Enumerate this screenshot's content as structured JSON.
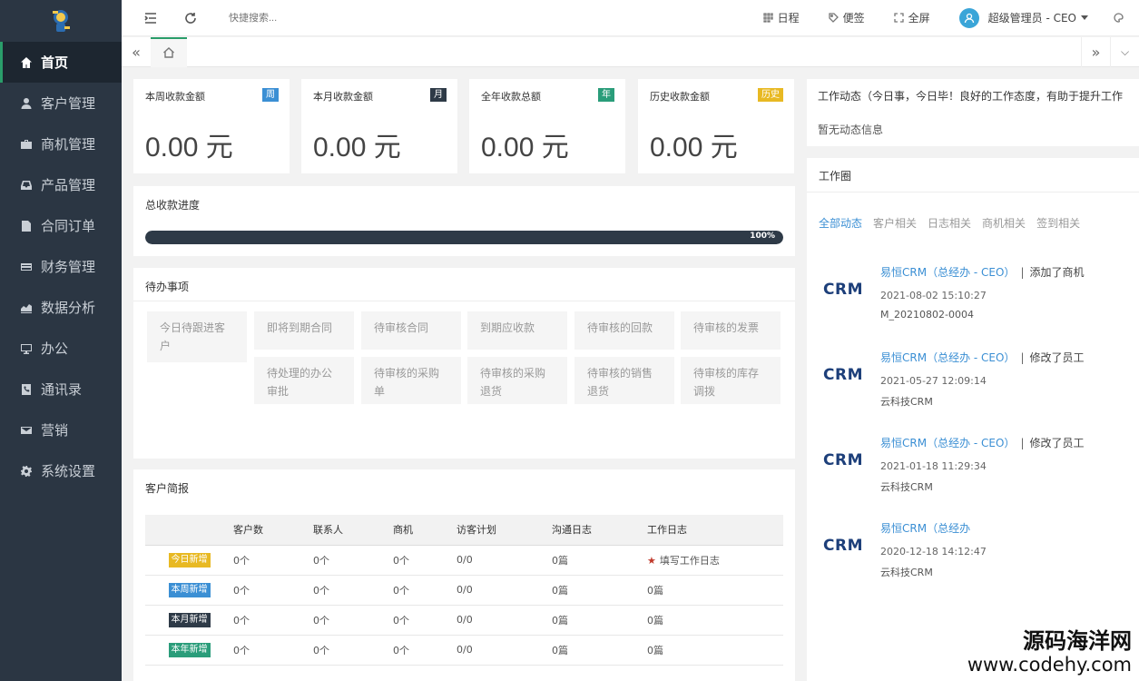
{
  "sidebar": {
    "items": [
      {
        "label": "首页",
        "icon": "home-icon"
      },
      {
        "label": "客户管理",
        "icon": "user-icon"
      },
      {
        "label": "商机管理",
        "icon": "briefcase-icon"
      },
      {
        "label": "产品管理",
        "icon": "inbox-icon"
      },
      {
        "label": "合同订单",
        "icon": "file-icon"
      },
      {
        "label": "财务管理",
        "icon": "credit-card-icon"
      },
      {
        "label": "数据分析",
        "icon": "area-chart-icon"
      },
      {
        "label": "办公",
        "icon": "desktop-icon"
      },
      {
        "label": "通讯录",
        "icon": "phone-icon"
      },
      {
        "label": "营销",
        "icon": "envelope-icon"
      },
      {
        "label": "系统设置",
        "icon": "gear-icon"
      }
    ]
  },
  "topbar": {
    "search_placeholder": "快捷搜索...",
    "schedule": "日程",
    "notes": "便签",
    "fullscreen": "全屏",
    "user": "超级管理员 - CEO"
  },
  "stats": [
    {
      "title": "本周收款金额",
      "badge": "周",
      "value": "0.00 元",
      "color": "#3b8fd4"
    },
    {
      "title": "本月收款金额",
      "badge": "月",
      "value": "0.00 元",
      "color": "#2e3a47"
    },
    {
      "title": "全年收款总额",
      "badge": "年",
      "value": "0.00 元",
      "color": "#2a9d7a"
    },
    {
      "title": "历史收款金额",
      "badge": "历史",
      "value": "0.00 元",
      "color": "#e8b923"
    }
  ],
  "progress": {
    "title": "总收款进度",
    "percent": 100,
    "label": "100%"
  },
  "todo": {
    "title": "待办事项",
    "items": [
      "今日待跟进客户",
      "即将到期合同",
      "待审核合同",
      "到期应收款",
      "待审核的回款",
      "待审核的发票",
      "待处理的办公审批",
      "待审核的采购单",
      "待审核的采购退货",
      "待审核的销售退货",
      "待审核的库存调拨"
    ]
  },
  "customer_report": {
    "title": "客户简报",
    "headers": [
      "",
      "客户数",
      "联系人",
      "商机",
      "访客计划",
      "沟通日志",
      "工作日志"
    ],
    "rows": [
      {
        "tag": "今日新增",
        "color": "#e8b923",
        "cells": [
          "0个",
          "0个",
          "0个",
          "0/0",
          "0篇",
          "填写工作日志"
        ]
      },
      {
        "tag": "本周新增",
        "color": "#3b8fd4",
        "cells": [
          "0个",
          "0个",
          "0个",
          "0/0",
          "0篇",
          "0篇"
        ]
      },
      {
        "tag": "本月新增",
        "color": "#2e3a47",
        "cells": [
          "0个",
          "0个",
          "0个",
          "0/0",
          "0篇",
          "0篇"
        ]
      },
      {
        "tag": "本年新增",
        "color": "#2a9d7a",
        "cells": [
          "0个",
          "0个",
          "0个",
          "0/0",
          "0篇",
          "0篇"
        ]
      }
    ]
  },
  "dynamics": {
    "title": "工作动态（今日事，今日毕！良好的工作态度，有助于提升工作",
    "empty": "暂无动态信息"
  },
  "work_circle": {
    "title": "工作圈",
    "filters": [
      "全部动态",
      "客户相关",
      "日志相关",
      "商机相关",
      "签到相关"
    ],
    "items": [
      {
        "logo": "CRM",
        "who": "易恒CRM（总经办 - CEO）",
        "action": "添加了商机",
        "time": "2021-08-02 15:10:27",
        "extra": "M_20210802-0004"
      },
      {
        "logo": "CRM",
        "who": "易恒CRM（总经办 - CEO）",
        "action": "修改了员工",
        "time": "2021-05-27 12:09:14",
        "extra": "云科技CRM"
      },
      {
        "logo": "CRM",
        "who": "易恒CRM（总经办 - CEO）",
        "action": "修改了员工",
        "time": "2021-01-18 11:29:34",
        "extra": "云科技CRM"
      },
      {
        "logo": "CRM",
        "who": "易恒CRM（总经办",
        "action": "",
        "time": "2020-12-18 14:12:47",
        "extra": "云科技CRM"
      }
    ]
  },
  "watermark": {
    "line1": "源码海洋网",
    "line2": "www.codehy.com"
  }
}
